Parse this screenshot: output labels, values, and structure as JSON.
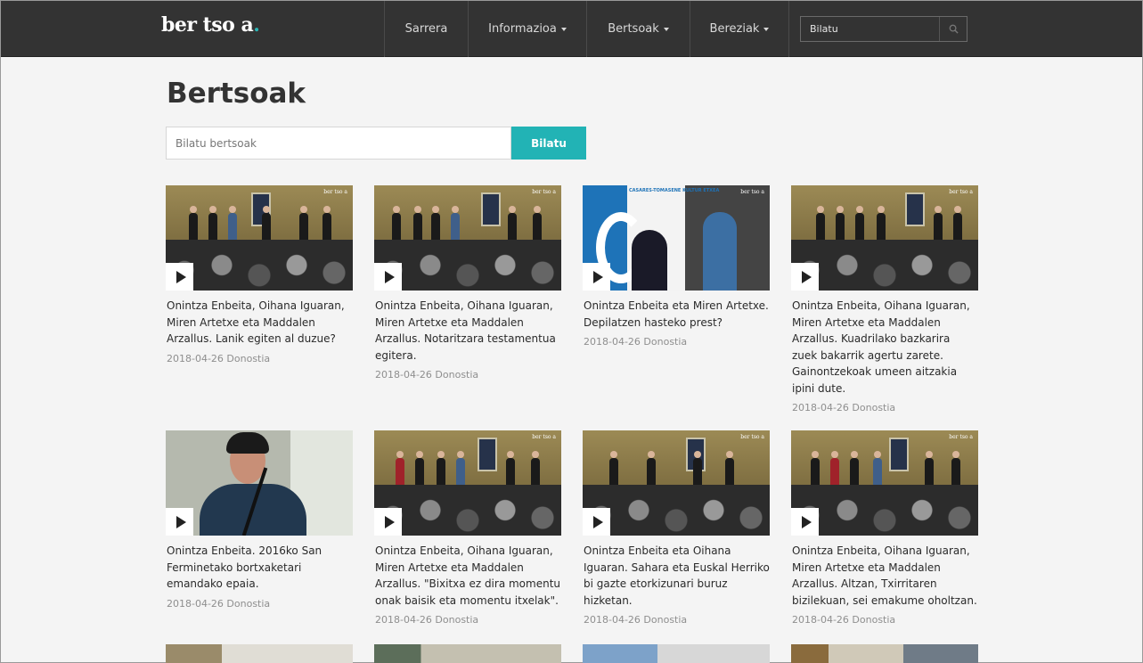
{
  "brand": {
    "logo_main": "ber tso a",
    "logo_dot": "."
  },
  "nav": {
    "items": [
      {
        "label": "Sarrera",
        "dropdown": false
      },
      {
        "label": "Informazioa",
        "dropdown": true
      },
      {
        "label": "Bertsoak",
        "dropdown": true
      },
      {
        "label": "Bereziak",
        "dropdown": true
      }
    ],
    "search_placeholder": "Bilatu",
    "search_icon": "search-icon"
  },
  "page": {
    "title": "Bertsoak",
    "search_placeholder": "Bilatu bertsoak",
    "search_button": "Bilatu"
  },
  "colors": {
    "accent": "#22b3b5",
    "navbar": "#333333",
    "background": "#f4f4f4"
  },
  "cards": [
    {
      "title": "Onintza Enbeita, Oihana Iguaran, Miren Artetxe eta Maddalen Arzallus. Lanik egiten al duzue?",
      "meta": "2018-04-26 Donostia",
      "thumb_brand": "ber tso a"
    },
    {
      "title": "Onintza Enbeita, Oihana Iguaran, Miren Artetxe eta Maddalen Arzallus. Notaritzara testamentua egitera.",
      "meta": "2018-04-26 Donostia",
      "thumb_brand": "ber tso a"
    },
    {
      "title": "Onintza Enbeita eta Miren Artetxe. Depilatzen hasteko prest?",
      "meta": "2018-04-26 Donostia",
      "thumb_brand": "ber tso a",
      "thumb_banner": "CASARES-TOMASENE KULTUR ETXEA"
    },
    {
      "title": "Onintza Enbeita, Oihana Iguaran, Miren Artetxe eta Maddalen Arzallus. Kuadrilako bazkarira zuek bakarrik agertu zarete. Gainontzekoak umeen aitzakia ipini dute.",
      "meta": "2018-04-26 Donostia",
      "thumb_brand": "ber tso a"
    },
    {
      "title": "Onintza Enbeita. 2016ko San Ferminetako bortxaketari emandako epaia.",
      "meta": "2018-04-26 Donostia",
      "thumb_brand": ""
    },
    {
      "title": "Onintza Enbeita, Oihana Iguaran, Miren Artetxe eta Maddalen Arzallus. \"Bixitxa ez dira momentu onak baisik eta momentu itxelak\".",
      "meta": "2018-04-26 Donostia",
      "thumb_brand": "ber tso a"
    },
    {
      "title": "Onintza Enbeita eta Oihana Iguaran. Sahara eta Euskal Herriko bi gazte etorkizunari buruz hizketan.",
      "meta": "2018-04-26 Donostia",
      "thumb_brand": "ber tso a"
    },
    {
      "title": "Onintza Enbeita, Oihana Iguaran, Miren Artetxe eta Maddalen Arzallus. Altzan, Txirritaren bizilekuan, sei emakume oholtzan.",
      "meta": "2018-04-26 Donostia",
      "thumb_brand": "ber tso a"
    }
  ]
}
